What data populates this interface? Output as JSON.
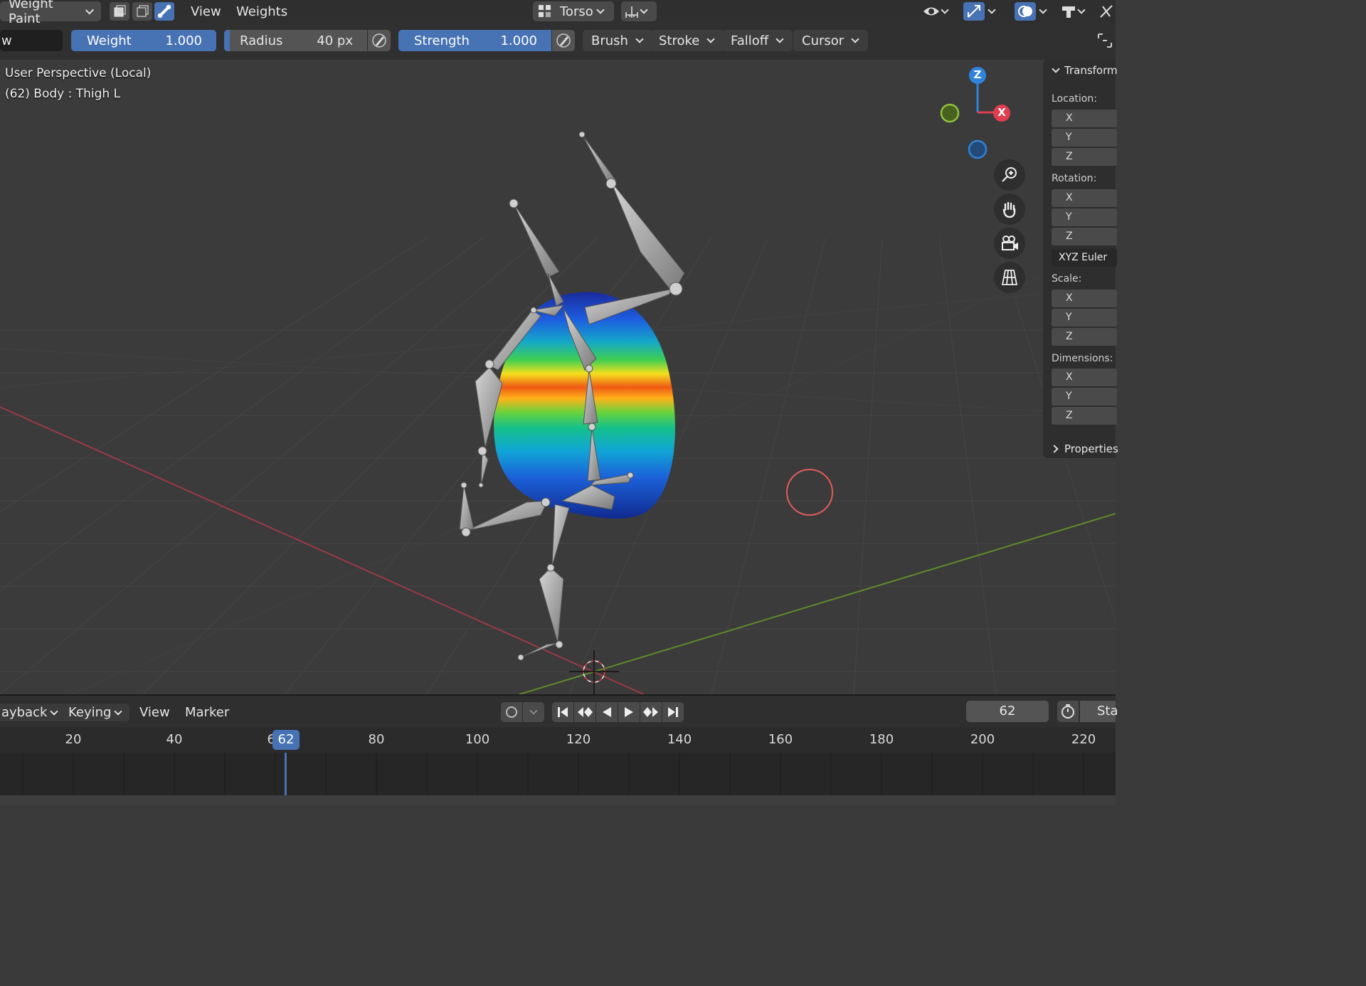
{
  "header": {
    "mode_label": "Weight Paint",
    "menus": [
      "View",
      "Weights"
    ],
    "armature_label": "Torso"
  },
  "toolsettings": {
    "name_field": "w",
    "weight": {
      "label": "Weight",
      "value": "1.000"
    },
    "radius": {
      "label": "Radius",
      "value": "40 px"
    },
    "strength": {
      "label": "Strength",
      "value": "1.000"
    },
    "menus": [
      "Brush",
      "Stroke",
      "Falloff",
      "Cursor"
    ]
  },
  "viewport": {
    "perspective_label": "User Perspective (Local)",
    "object_label": "(62) Body : Thigh L",
    "gizmo": {
      "z": "Z",
      "x": "X"
    },
    "colors": {
      "x_axis": "#e03e4f",
      "y_axis": "#6aa02c",
      "z_axis": "#2f83dc",
      "selected": "#4772b3"
    }
  },
  "npanel": {
    "transform_title": "Transform",
    "location_label": "Location:",
    "rotation_label": "Rotation:",
    "rotation_mode": "XYZ Euler",
    "scale_label": "Scale:",
    "dimensions_label": "Dimensions:",
    "axes": [
      "X",
      "Y",
      "Z"
    ],
    "properties_title": "Properties"
  },
  "timeline": {
    "menus": {
      "playback": "ayback",
      "keying": "Keying",
      "view": "View",
      "marker": "Marker"
    },
    "current_frame": "62",
    "start_label": "Sta",
    "ticks": [
      "20",
      "40",
      "60",
      "80",
      "100",
      "120",
      "140",
      "160",
      "180",
      "200",
      "220"
    ]
  }
}
